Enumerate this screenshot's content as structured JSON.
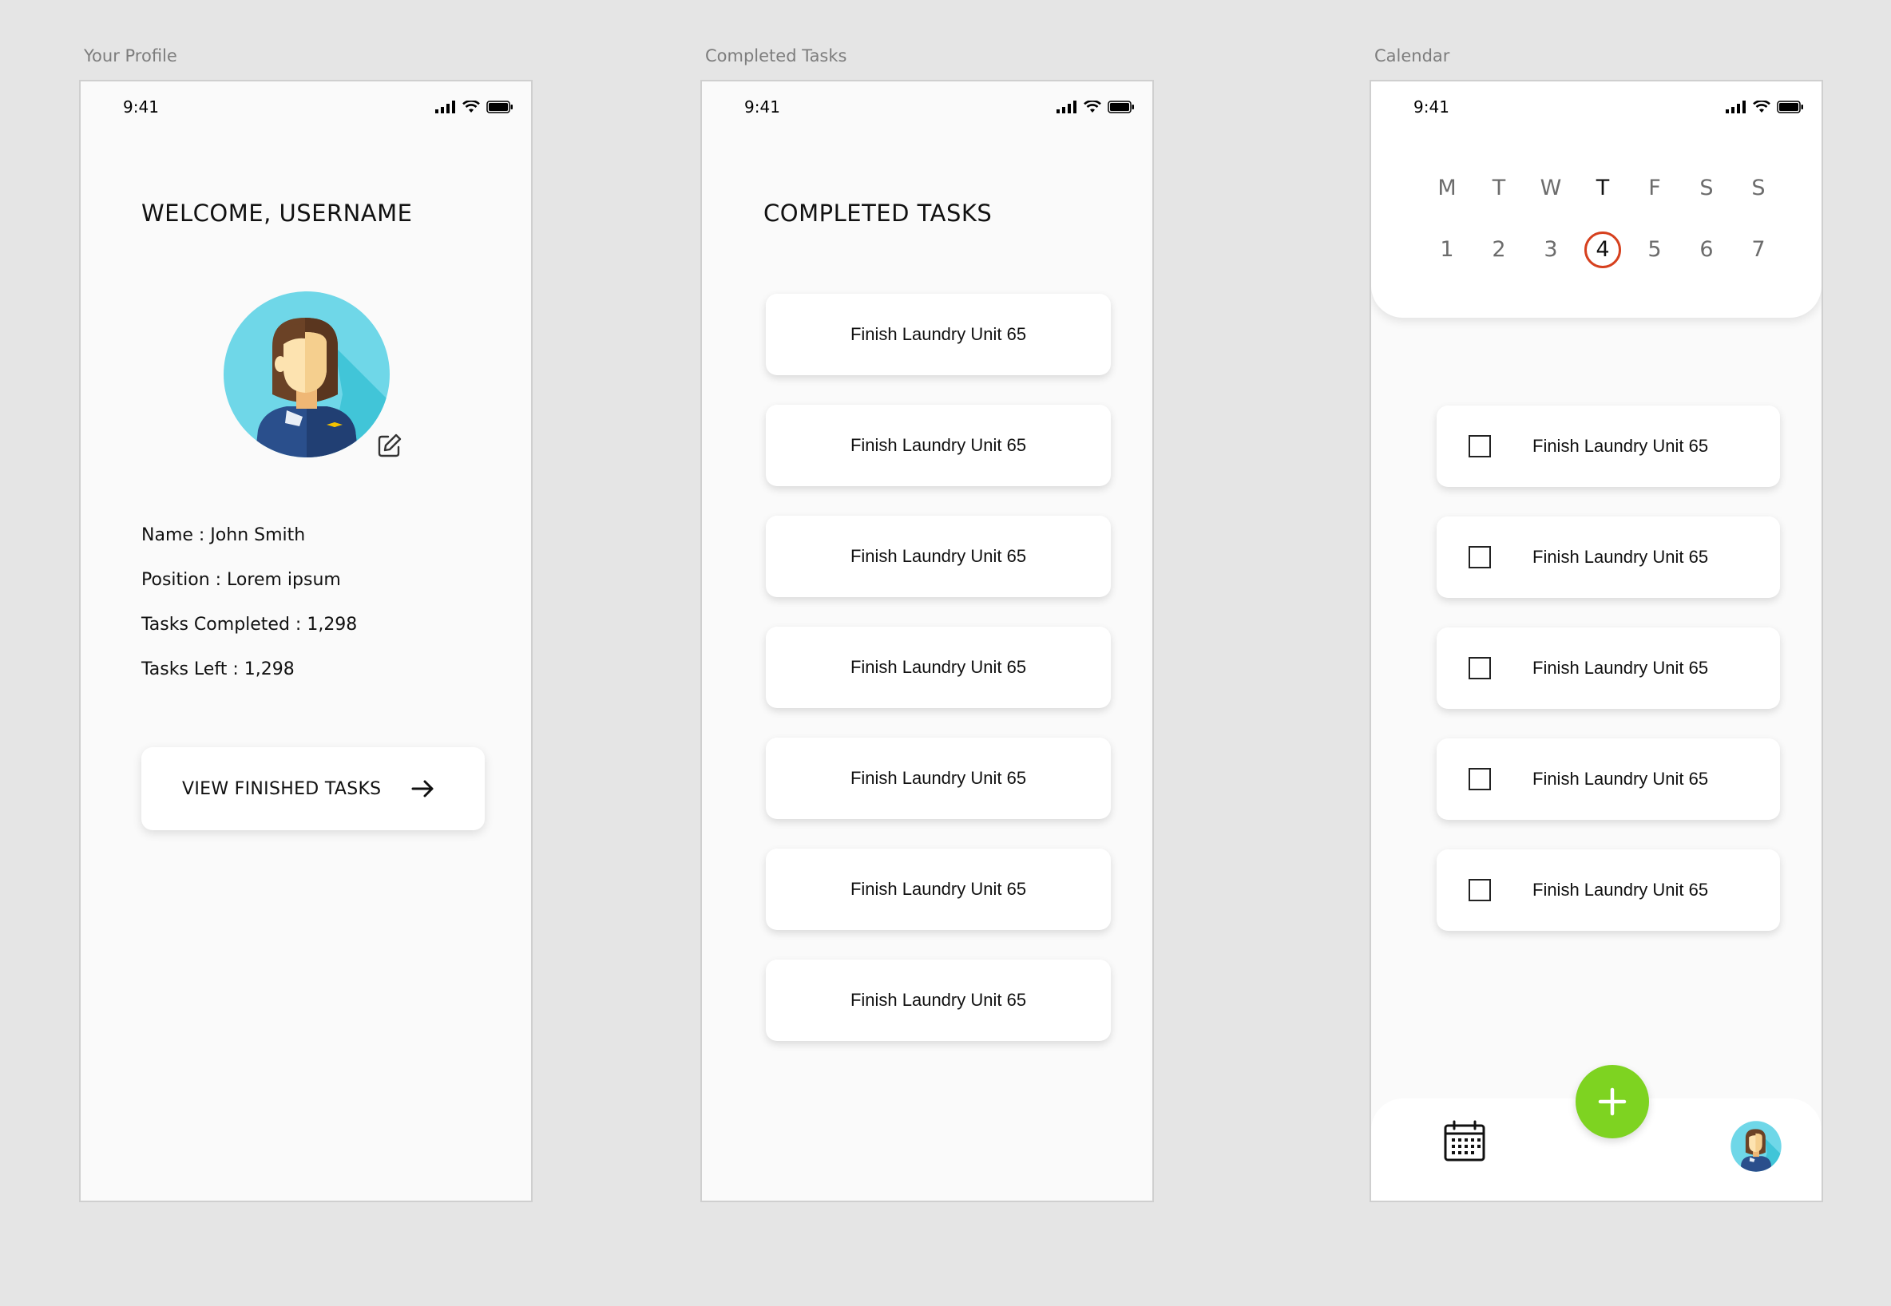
{
  "artboards": {
    "profile_label": "Your Profile",
    "completed_label": "Completed Tasks",
    "calendar_label": "Calendar"
  },
  "status_bar": {
    "time": "9:41"
  },
  "profile": {
    "title": "WELCOME, USERNAME",
    "name_line": "Name : John Smith",
    "position_line": "Position : Lorem ipsum",
    "tasks_completed_line": "Tasks Completed : 1,298",
    "tasks_left_line": "Tasks Left : 1,298",
    "view_button_label": "VIEW FINISHED TASKS"
  },
  "completed_tasks": {
    "title": "COMPLETED TASKS",
    "items": [
      "Finish Laundry Unit 65",
      "Finish Laundry Unit 65",
      "Finish Laundry Unit 65",
      "Finish Laundry Unit 65",
      "Finish Laundry Unit 65",
      "Finish Laundry Unit 65",
      "Finish Laundry Unit 65"
    ]
  },
  "calendar": {
    "days": [
      "M",
      "T",
      "W",
      "T",
      "F",
      "S",
      "S"
    ],
    "dates": [
      "1",
      "2",
      "3",
      "4",
      "5",
      "6",
      "7"
    ],
    "today_index": 3,
    "selected_color": "#d6401e",
    "tasks": [
      {
        "label": "Finish Laundry Unit 65",
        "checked": false
      },
      {
        "label": "Finish Laundry Unit 65",
        "checked": false
      },
      {
        "label": "Finish Laundry Unit 65",
        "checked": false
      },
      {
        "label": "Finish Laundry Unit 65",
        "checked": false
      },
      {
        "label": "Finish Laundry Unit 65",
        "checked": false
      }
    ],
    "fab_color": "#7ed321",
    "fab_icon": "plus-icon"
  },
  "colors": {
    "background": "#e5e5e5",
    "phone_bg": "#fafafa",
    "avatar_bg": "#6fd7e8"
  }
}
